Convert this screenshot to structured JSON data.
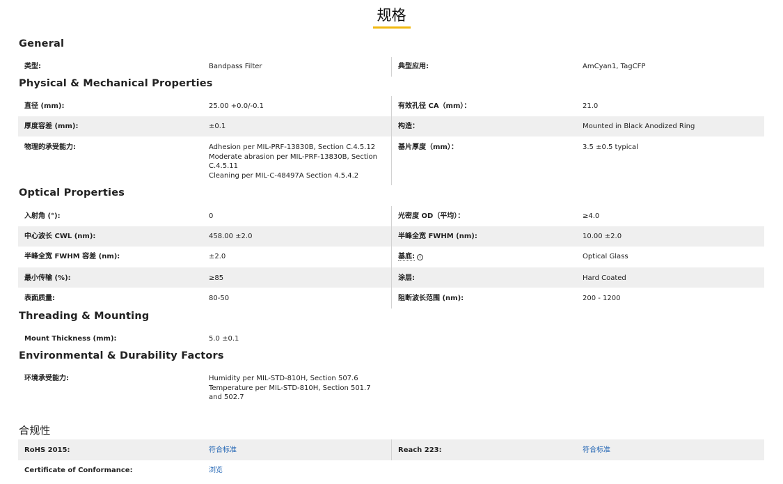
{
  "page": {
    "title": "规格"
  },
  "sections": {
    "general": {
      "title": "General",
      "rows": [
        {
          "l1": "类型:",
          "v1": "Bandpass Filter",
          "l2": "典型应用:",
          "v2": "AmCyan1, TagCFP"
        }
      ]
    },
    "physical": {
      "title": "Physical & Mechanical Properties",
      "rows": [
        {
          "l1": "直径 (mm):",
          "v1": "25.00 +0.0/-0.1",
          "l2": "有效孔径 CA（mm）：",
          "v2": "21.0"
        },
        {
          "l1": "厚度容差 (mm):",
          "v1": "±0.1",
          "l2": "构造：",
          "v2": "Mounted in Black Anodized Ring"
        },
        {
          "l1": "物理的承受能力:",
          "v1": [
            "Adhesion per MIL-PRF-13830B, Section C.4.5.12",
            "Moderate abrasion per MIL-PRF-13830B, Section C.4.5.11",
            "Cleaning per MIL-C-48497A Section 4.5.4.2"
          ],
          "l2": "基片厚度（mm）：",
          "v2": "3.5 ±0.5 typical"
        }
      ]
    },
    "optical": {
      "title": "Optical Properties",
      "rows": [
        {
          "l1": "入射角 (°):",
          "v1": "0",
          "l2": "光密度 OD（平均）：",
          "v2": "≥4.0"
        },
        {
          "l1": "中心波长 CWL (nm):",
          "v1": "458.00 ±2.0",
          "l2": "半峰全宽 FWHM (nm):",
          "v2": "10.00 ±2.0"
        },
        {
          "l1": "半峰全宽 FWHM 容差 (nm):",
          "v1": "±2.0",
          "l2": "基底:",
          "v2": "Optical Glass"
        },
        {
          "l1": "最小传输 (%):",
          "v1": "≥85",
          "l2": "涂层:",
          "v2": "Hard Coated"
        },
        {
          "l1": "表面质量:",
          "v1": "80-50",
          "l2": "阻断波长范围 (nm):",
          "v2": "200 - 1200"
        }
      ]
    },
    "threading": {
      "title": "Threading & Mounting",
      "rows": [
        {
          "l1": "Mount Thickness (mm):",
          "v1": "5.0 ±0.1"
        }
      ]
    },
    "environmental": {
      "title": "Environmental & Durability Factors",
      "rows": [
        {
          "l1": "环境承受能力:",
          "v1": [
            "Humidity per MIL-STD-810H, Section 507.6",
            "Temperature per MIL-STD-810H, Section 501.7 and 502.7"
          ]
        }
      ]
    },
    "compliance": {
      "title": "合规性",
      "rows": [
        {
          "l1": "RoHS 2015:",
          "v1": "符合标准",
          "l2": "Reach 223:",
          "v2": "符合标准"
        },
        {
          "l1": "Certificate of Conformance:",
          "v1": "浏览"
        }
      ]
    }
  },
  "icons": {
    "substrate_info": "info-circle-icon"
  },
  "colors": {
    "accent_underline": "#f1b80f",
    "row_shading": "#efefef",
    "link": "#1f63b3"
  }
}
